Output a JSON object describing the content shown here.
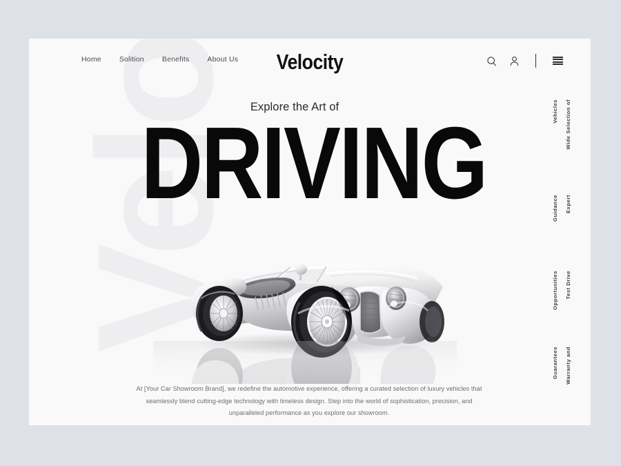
{
  "theme": {
    "page_background": "#dfe1e8",
    "card_background": "#f9f9f9",
    "watermark_color": "#eeeef1",
    "ink": "#090909",
    "muted_text": "#6d6d72",
    "nav_text": "#4a4a4d"
  },
  "header": {
    "logo": "Velocity",
    "nav": [
      {
        "label": "Home"
      },
      {
        "label": "Solition"
      },
      {
        "label": "Benefits"
      },
      {
        "label": "About Us"
      }
    ],
    "actions": [
      {
        "name": "search-icon",
        "label": "Search"
      },
      {
        "name": "account-icon",
        "label": "Account"
      },
      {
        "name": "menu-icon",
        "label": "Menu"
      }
    ]
  },
  "watermark": {
    "text": "Velocity"
  },
  "hero": {
    "eyebrow": "Explore the Art of",
    "headline": "DRIVING",
    "image_alt": "white classic roadster sports car"
  },
  "features": [
    {
      "line1": "Wide Selection of",
      "line2": "Vehicles"
    },
    {
      "line1": "Expert",
      "line2": "Guidance"
    },
    {
      "line1": "Test Drive",
      "line2": "Opportunities"
    },
    {
      "line1": "Warranty and",
      "line2": "Guarantees"
    }
  ],
  "intro": {
    "paragraph": "At [Your Car Showroom Brand], we redefine the automotive experience, offering a curated selection of luxury vehicles that seamlessly blend cutting-edge technology with timeless design. Step into the world of sophistication, precision, and unparalleled performance as you explore our showroom."
  }
}
